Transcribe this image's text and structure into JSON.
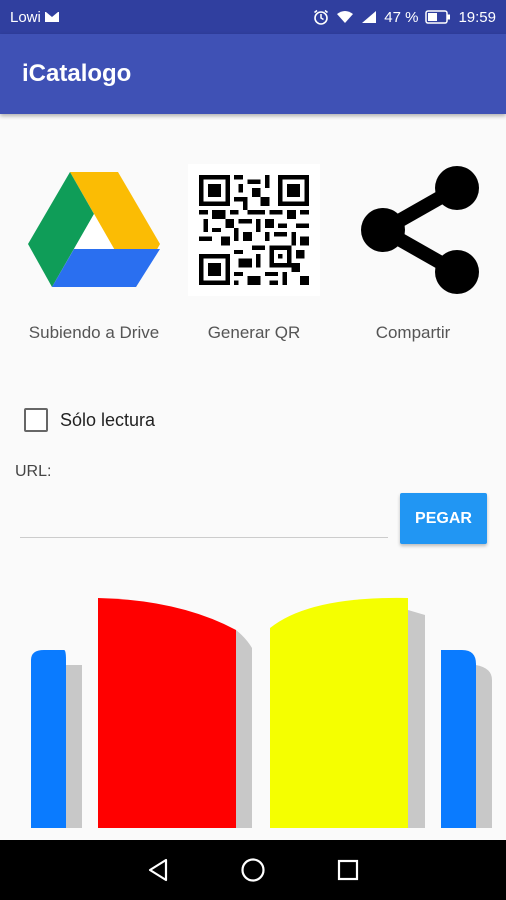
{
  "status_bar": {
    "carrier": "Lowi",
    "battery_percent": "47 %",
    "time": "19:59"
  },
  "app_bar": {
    "title": "iCatalogo"
  },
  "actions": [
    {
      "label": "Subiendo a Drive",
      "icon": "google-drive-icon"
    },
    {
      "label": "Generar QR",
      "icon": "qr-code-icon"
    },
    {
      "label": "Compartir",
      "icon": "share-icon"
    }
  ],
  "read_only": {
    "label": "Sólo lectura",
    "checked": false
  },
  "url": {
    "label": "URL:",
    "value": "",
    "paste_label": "PEGAR"
  },
  "colors": {
    "status_bar": "#303f9f",
    "app_bar": "#3f51b5",
    "accent": "#2196f3",
    "book_red": "#ff0000",
    "book_yellow": "#f5ff00",
    "book_blue": "#0a7bff"
  },
  "nav": [
    "back-icon",
    "home-icon",
    "recents-icon"
  ]
}
